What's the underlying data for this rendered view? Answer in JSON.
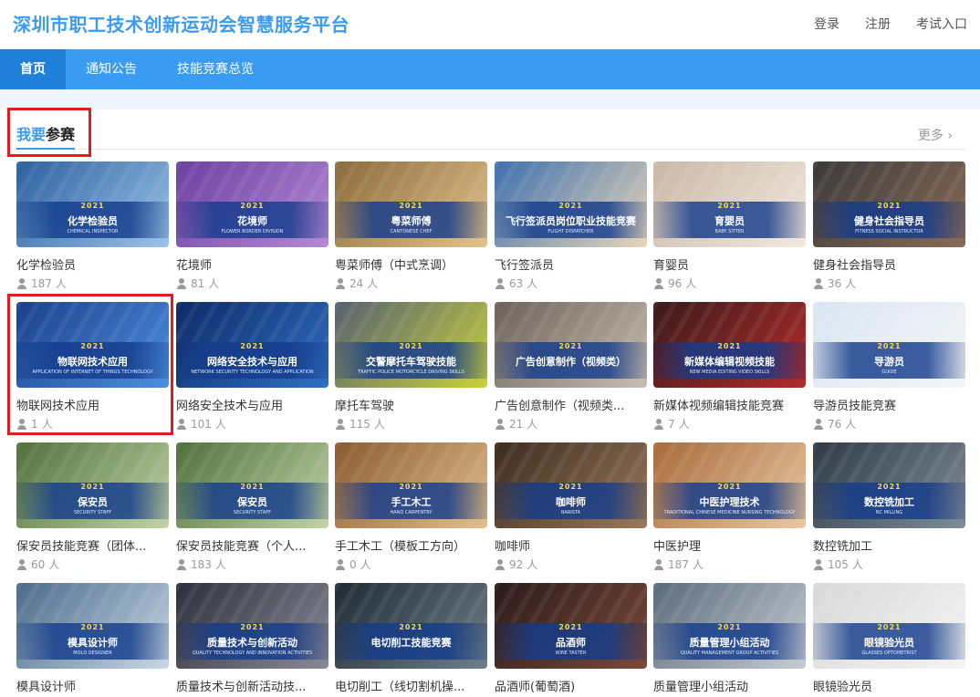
{
  "header": {
    "site_title": "深圳市职工技术创新运动会智慧服务平台",
    "links": [
      "登录",
      "注册",
      "考试入口"
    ]
  },
  "nav": {
    "items": [
      "首页",
      "通知公告",
      "技能竞赛总览"
    ],
    "active_index": 0
  },
  "section": {
    "title_part1": "我要",
    "title_part2": "参赛",
    "more_label": "更多 ›"
  },
  "unit": "人",
  "colors": {
    "brand": "#3a9bf2",
    "nav_active": "#1f7fdb",
    "highlight": "#e41c1c"
  },
  "cards": [
    {
      "name": "化学检验员",
      "count": "187",
      "year": "2021",
      "title_cn": "化学检验员",
      "title_en": "CHEMICAL INSPECTOR",
      "c1": "#2b5f9e",
      "c2": "#9cc4e8"
    },
    {
      "name": "花境师",
      "count": "81",
      "year": "2021",
      "title_cn": "花境师",
      "title_en": "FLOWER BORDER DIVISION",
      "c1": "#6b3fa0",
      "c2": "#b58ad6"
    },
    {
      "name": "粤菜师傅（中式烹调）",
      "count": "24",
      "year": "2021",
      "title_cn": "粤菜师傅",
      "title_en": "CANTONESE CHEF",
      "c1": "#8a6a3a",
      "c2": "#e3c48d"
    },
    {
      "name": "飞行签派员",
      "count": "63",
      "year": "2021",
      "title_cn": "飞行签派员岗位职业技能竞赛",
      "title_en": "FLIGHT DISPATCHER",
      "c1": "#3d6fae",
      "c2": "#e8d6b8"
    },
    {
      "name": "育婴员",
      "count": "96",
      "year": "2021",
      "title_cn": "育婴员",
      "title_en": "BABY SITTER",
      "c1": "#c9b7a6",
      "c2": "#f2e9df"
    },
    {
      "name": "健身社会指导员",
      "count": "36",
      "year": "2021",
      "title_cn": "健身社会指导员",
      "title_en": "FITNESS SOCIAL INSTRUCTOR",
      "c1": "#3a3a3a",
      "c2": "#8a6b57"
    },
    {
      "name": "物联网技术应用",
      "count": "1",
      "year": "2021",
      "title_cn": "物联网技术应用",
      "title_en": "APPLICATION OF INTERNET OF THINGS TECHNOLOGY",
      "c1": "#1b3f8a",
      "c2": "#4d8fe0"
    },
    {
      "name": "网络安全技术与应用",
      "count": "101",
      "year": "2021",
      "title_cn": "网络安全技术与应用",
      "title_en": "NETWORK SECURITY TECHNOLOGY AND APPLICATION",
      "c1": "#0d2a66",
      "c2": "#2f6fc4"
    },
    {
      "name": "摩托车驾驶",
      "count": "115",
      "year": "2021",
      "title_cn": "交警摩托车驾驶技能",
      "title_en": "TRAFFIC POLICE MOTORCYCLE DRIVING SKILLS",
      "c1": "#556070",
      "c2": "#c9d23a"
    },
    {
      "name": "广告创意制作（视频类...",
      "count": "21",
      "year": "2021",
      "title_cn": "广告创意制作（视频类）",
      "title_en": "",
      "c1": "#6a6258",
      "c2": "#c7bfb3"
    },
    {
      "name": "新媒体视频编辑技能竞赛",
      "count": "7",
      "year": "2021",
      "title_cn": "新媒体编辑视频技能",
      "title_en": "NEW MEDIA EDITING VIDEO SKILLS",
      "c1": "#3a1a1a",
      "c2": "#b32b2b"
    },
    {
      "name": "导游员技能竞赛",
      "count": "76",
      "year": "2021",
      "title_cn": "导游员",
      "title_en": "GUIDE",
      "c1": "#d9e6f2",
      "c2": "#f5f5f5"
    },
    {
      "name": "保安员技能竞赛（团体...",
      "count": "60",
      "year": "2021",
      "title_cn": "保安员",
      "title_en": "SECURITY STAFF",
      "c1": "#4f6f3a",
      "c2": "#c2d4a8"
    },
    {
      "name": "保安员技能竞赛（个人...",
      "count": "183",
      "year": "2021",
      "title_cn": "保安员",
      "title_en": "SECURITY STAFF",
      "c1": "#4f6f3a",
      "c2": "#c2d4a8"
    },
    {
      "name": "手工木工（模板工方向）",
      "count": "0",
      "year": "2021",
      "title_cn": "手工木工",
      "title_en": "HAND CARPENTRY",
      "c1": "#8a5a2e",
      "c2": "#e2c08f"
    },
    {
      "name": "咖啡师",
      "count": "92",
      "year": "2021",
      "title_cn": "咖啡师",
      "title_en": "BARISTA",
      "c1": "#3b2a1f",
      "c2": "#9a7a5c"
    },
    {
      "name": "中医护理",
      "count": "187",
      "year": "2021",
      "title_cn": "中医护理技术",
      "title_en": "TRADITIONAL CHINESE MEDICINE NURSING TECHNOLOGY",
      "c1": "#a86a3a",
      "c2": "#e8c9a4"
    },
    {
      "name": "数控铣加工",
      "count": "105",
      "year": "2021",
      "title_cn": "数控铣加工",
      "title_en": "NC MILLING",
      "c1": "#2f3a44",
      "c2": "#7f8d99"
    },
    {
      "name": "模具设计师",
      "count": "",
      "year": "2021",
      "title_cn": "模具设计师",
      "title_en": "MOLD DESIGNER",
      "c1": "#4a6a8a",
      "c2": "#c9d8e6"
    },
    {
      "name": "质量技术与创新活动技...",
      "count": "",
      "year": "2021",
      "title_cn": "质量技术与创新活动",
      "title_en": "QUALITY TECHNOLOGY AND INNOVATION ACTIVITIES",
      "c1": "#2e2e3a",
      "c2": "#8a8a99"
    },
    {
      "name": "电切削工（线切割机操...",
      "count": "",
      "year": "2021",
      "title_cn": "电切削工技能竞赛",
      "title_en": "",
      "c1": "#1f2a33",
      "c2": "#6f7f8a"
    },
    {
      "name": "品酒师(葡萄酒)",
      "count": "",
      "year": "2021",
      "title_cn": "品酒师",
      "title_en": "WINE TASTER",
      "c1": "#2a1a1a",
      "c2": "#7a4a3a"
    },
    {
      "name": "质量管理小组活动",
      "count": "",
      "year": "2021",
      "title_cn": "质量管理小组活动",
      "title_en": "QUALITY MANAGEMENT GROUP ACTIVITIES",
      "c1": "#5a6a7a",
      "c2": "#c7cdd4"
    },
    {
      "name": "眼镜验光员",
      "count": "",
      "year": "2021",
      "title_cn": "眼镜验光员",
      "title_en": "GLASSES OPTOMETRIST",
      "c1": "#d8d8d8",
      "c2": "#f4f4f4"
    }
  ]
}
